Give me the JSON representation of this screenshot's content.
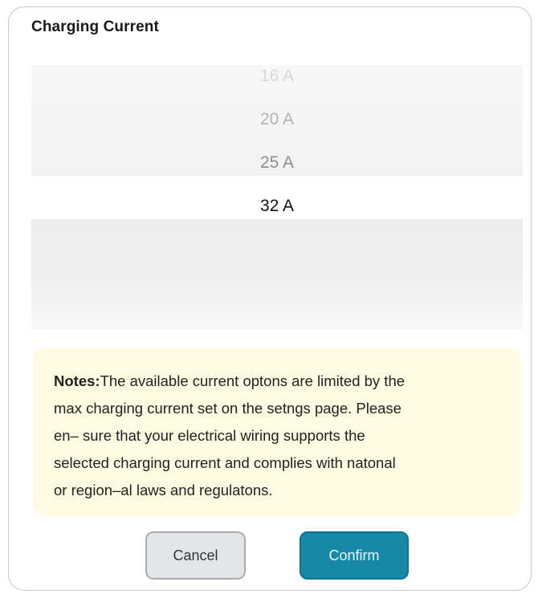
{
  "dialog": {
    "title": "Charging Current",
    "options": [
      "16 A",
      "20 A",
      "25 A",
      "32 A"
    ],
    "selected_value": "32 A",
    "notes_label": "Notes:",
    "notes_lines": [
      "The available current optons are limited by the",
      "max charging current set on the setngs page. Please",
      "en– sure that your electrical wiring supports the",
      "selected charging current and complies with natonal",
      "or region–al laws and regulatons."
    ],
    "cancel_label": "Cancel",
    "confirm_label": "Confirm"
  },
  "colors": {
    "accent": "#1689a7",
    "notes_background": "#fefbe2",
    "cancel_background": "#e3e6e9"
  }
}
